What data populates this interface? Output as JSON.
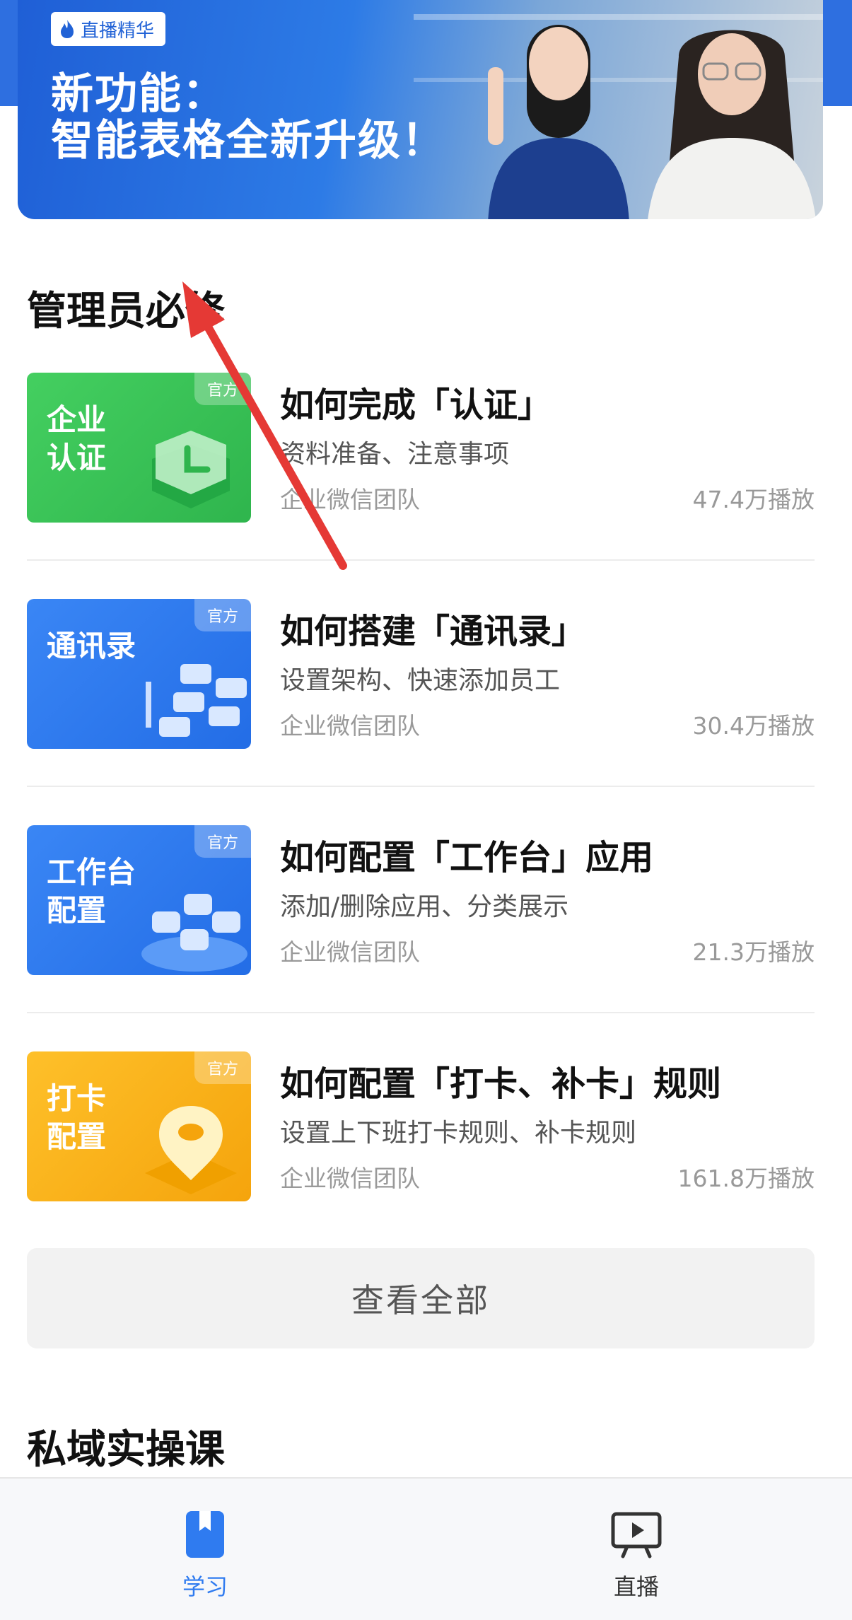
{
  "banner": {
    "badge_label": "直播精华",
    "title_line1": "新功能：",
    "title_line2": "智能表格全新升级！"
  },
  "section_admin": {
    "title": "管理员必修",
    "courses": [
      {
        "thumb_text": "企业\n认证",
        "tag": "官方",
        "title": "如何完成「认证」",
        "desc": "资料准备、注意事项",
        "author": "企业微信团队",
        "plays": "47.4万播放",
        "color": "#3cc45a"
      },
      {
        "thumb_text": "通讯录",
        "tag": "官方",
        "title": "如何搭建「通讯录」",
        "desc": "设置架构、快速添加员工",
        "author": "企业微信团队",
        "plays": "30.4万播放",
        "color": "#2f7bf0"
      },
      {
        "thumb_text": "工作台\n配置",
        "tag": "官方",
        "title": "如何配置「工作台」应用",
        "desc": "添加/删除应用、分类展示",
        "author": "企业微信团队",
        "plays": "21.3万播放",
        "color": "#2f7bf0"
      },
      {
        "thumb_text": "打卡\n配置",
        "tag": "官方",
        "title": "如何配置「打卡、补卡」规则",
        "desc": "设置上下班打卡规则、补卡规则",
        "author": "企业微信团队",
        "plays": "161.8万播放",
        "color": "#fbb51a"
      }
    ],
    "view_all_label": "查看全部"
  },
  "section_private": {
    "title": "私域实操课"
  },
  "tabbar": {
    "items": [
      {
        "label": "学习",
        "icon": "book-icon",
        "active": true
      },
      {
        "label": "直播",
        "icon": "live-screen-icon",
        "active": false
      }
    ],
    "active_color": "#2f7bf0",
    "inactive_color": "#333333"
  },
  "overlay": {
    "arrow_color": "#e53935"
  }
}
